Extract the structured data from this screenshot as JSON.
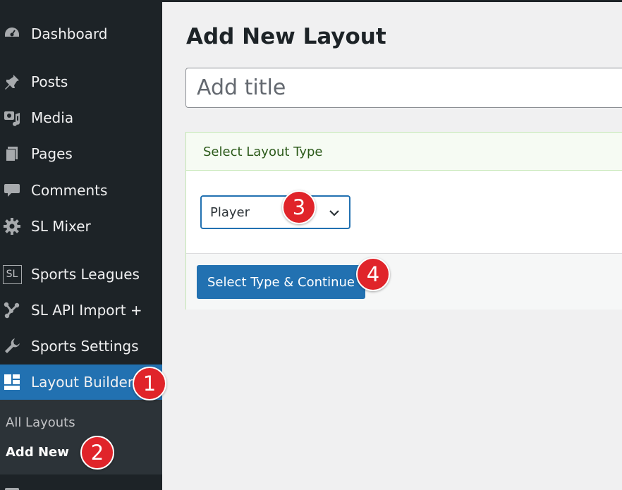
{
  "sidebar": {
    "items": [
      {
        "label": "Dashboard",
        "icon": "dashboard-icon"
      },
      {
        "label": "Posts",
        "icon": "pushpin-icon"
      },
      {
        "label": "Media",
        "icon": "media-icon"
      },
      {
        "label": "Pages",
        "icon": "pages-icon"
      },
      {
        "label": "Comments",
        "icon": "comment-icon"
      },
      {
        "label": "SL Mixer",
        "icon": "gear-icon"
      },
      {
        "label": "Sports Leagues",
        "icon": "sl-logo-icon",
        "icon_text": "SL"
      },
      {
        "label": "SL API Import +",
        "icon": "network-icon"
      },
      {
        "label": "Sports Settings",
        "icon": "wrench-icon"
      },
      {
        "label": "Layout Builder",
        "icon": "layout-grid-icon",
        "current": true
      }
    ],
    "submenu": [
      {
        "label": "All Layouts"
      },
      {
        "label": "Add New",
        "active": true
      }
    ]
  },
  "badges": [
    "1",
    "2",
    "3",
    "4"
  ],
  "main": {
    "title": "Add New Layout",
    "title_input": {
      "placeholder": "Add title",
      "value": ""
    },
    "layout_box": {
      "header": "Select Layout Type",
      "select_value": "Player",
      "button_label": "Select Type & Continue"
    }
  },
  "colors": {
    "sidebar_bg": "#1d2327",
    "accent": "#2271b1",
    "badge": "#e0242a",
    "box_border": "#c3e6b4"
  }
}
